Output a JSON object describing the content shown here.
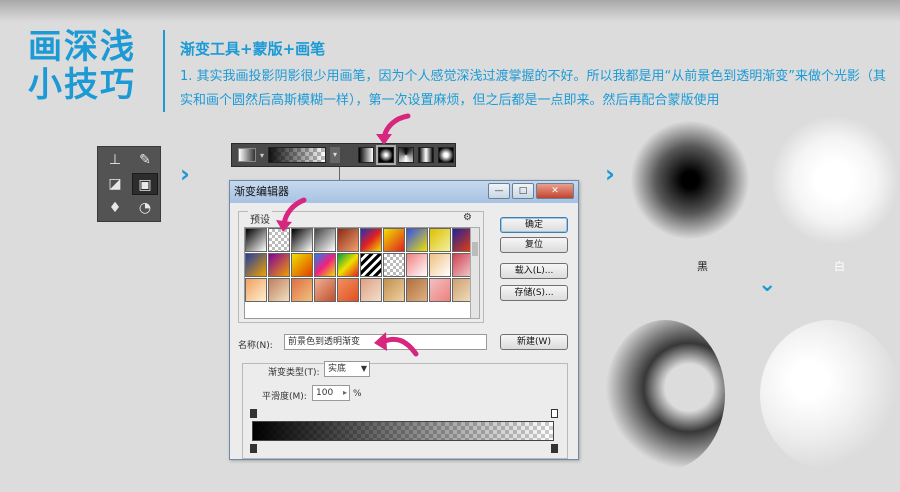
{
  "header": {
    "big_title_line1": "画深浅",
    "big_title_line2": "小技巧",
    "heading": "渐变工具+蒙版+画笔",
    "description": "1. 其实我画投影阴影很少用画笔，因为个人感觉深浅过渡掌握的不好。所以我都是用“从前景色到透明渐变”来做个光影（其实和画个圆然后高斯模糊一样），第一次设置麻烦，但之后都是一点即来。然后再配合蒙版使用"
  },
  "dialog": {
    "title": "渐变编辑器",
    "presets_label": "预设",
    "buttons": {
      "ok": "确定",
      "reset": "复位",
      "load": "载入(L)...",
      "save": "存储(S)...",
      "new": "新建(W)"
    },
    "name_label": "名称(N):",
    "name_value": "前景色到透明渐变",
    "type_label": "渐变类型(T):",
    "type_value": "实底",
    "smooth_label": "平滑度(M):",
    "smooth_value": "100",
    "smooth_unit": "%"
  },
  "labels": {
    "black": "黑",
    "white": "白"
  },
  "colors": {
    "accent": "#1b9ad6",
    "pointer": "#d6267e"
  },
  "icons": {
    "optionbar": [
      "linear-gradient-icon",
      "radial-gradient-icon",
      "angle-gradient-icon",
      "reflected-gradient-icon",
      "diamond-gradient-icon"
    ],
    "toolbox": [
      "stamp-icon",
      "history-brush-icon",
      "eraser-icon",
      "gradient-tool-icon",
      "blur-icon",
      "dodge-icon"
    ]
  }
}
